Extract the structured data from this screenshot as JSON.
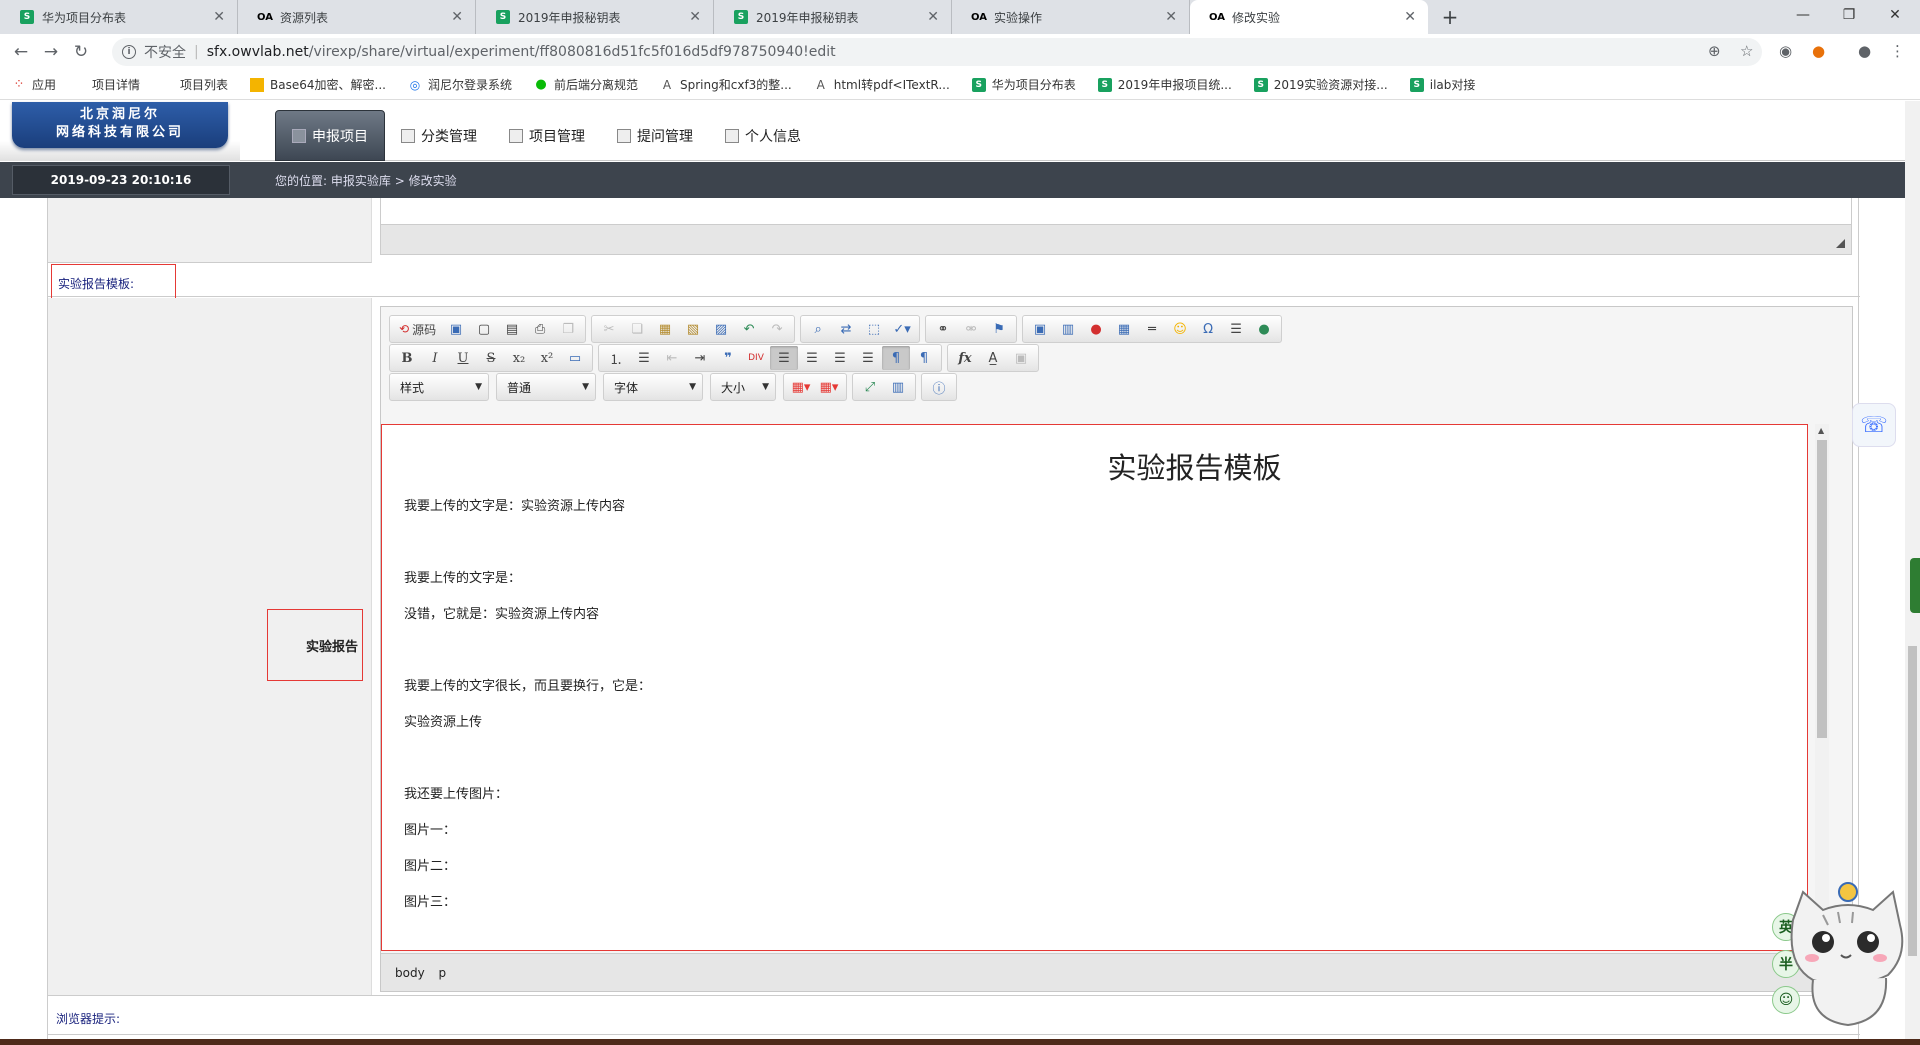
{
  "browser": {
    "tabs": [
      {
        "label": "华为项目分布表",
        "favicon": "S"
      },
      {
        "label": "资源列表",
        "favicon": "OA"
      },
      {
        "label": "2019年申报秘钥表",
        "favicon": "S"
      },
      {
        "label": "2019年申报秘钥表",
        "favicon": "S"
      },
      {
        "label": "实验操作",
        "favicon": "OA"
      },
      {
        "label": "修改实验",
        "favicon": "OA",
        "active": true
      }
    ],
    "security_label": "不安全",
    "url_host": "sfx.owvlab.net",
    "url_path": "/virexp/share/virtual/experiment/ff8080816d51fc5f016d5df978750940!edit",
    "bookmarks": [
      {
        "label": "应用",
        "icon": "apps-grid-icon"
      },
      {
        "label": "项目详情",
        "icon": ""
      },
      {
        "label": "项目列表",
        "icon": ""
      },
      {
        "label": "Base64加密、解密...",
        "icon": "base64-icon"
      },
      {
        "label": "润尼尔登录系统",
        "icon": "globe-icon"
      },
      {
        "label": "前后端分离规范",
        "icon": "wechat-icon"
      },
      {
        "label": "Spring和cxf3的整...",
        "icon": "bird-icon"
      },
      {
        "label": "html转pdf<ITextR...",
        "icon": "bird-icon"
      },
      {
        "label": "华为项目分布表",
        "icon": "sheet-icon"
      },
      {
        "label": "2019年申报项目统...",
        "icon": "sheet-icon"
      },
      {
        "label": "2019实验资源对接...",
        "icon": "sheet-icon"
      },
      {
        "label": "ilab对接",
        "icon": "sheet-icon"
      }
    ]
  },
  "app": {
    "logo_line1": "北京润尼尔",
    "logo_line2": "网络科技有限公司",
    "nav": [
      {
        "label": "申报项目",
        "active": true
      },
      {
        "label": "分类管理"
      },
      {
        "label": "项目管理"
      },
      {
        "label": "提问管理"
      },
      {
        "label": "个人信息"
      }
    ],
    "datetime": "2019-09-23   20:10:16",
    "breadcrumb_prefix": "您的位置:",
    "breadcrumb_1": "申报实验库",
    "breadcrumb_sep": ">",
    "breadcrumb_2": "修改实验"
  },
  "form": {
    "template_label": "实验报告模板:",
    "report_label": "实验报告",
    "hint_label": "浏览器提示:"
  },
  "editor": {
    "source_label": "源码",
    "style_combo": "样式",
    "format_combo": "普通",
    "font_combo": "字体",
    "size_combo": "大小",
    "doc_title": "实验报告模板",
    "paragraphs": [
      "我要上传的文字是：实验资源上传内容",
      "",
      "我要上传的文字是：",
      "没错，它就是：实验资源上传内容",
      "",
      "我要上传的文字很长，而且要换行，它是：",
      "实验资源上传",
      "",
      "我还要上传图片：",
      "图片一：",
      "图片二：",
      "图片三："
    ],
    "path_1": "body",
    "path_2": "p"
  },
  "mascot": {
    "bubble_1": "英",
    "bubble_2": "半"
  }
}
